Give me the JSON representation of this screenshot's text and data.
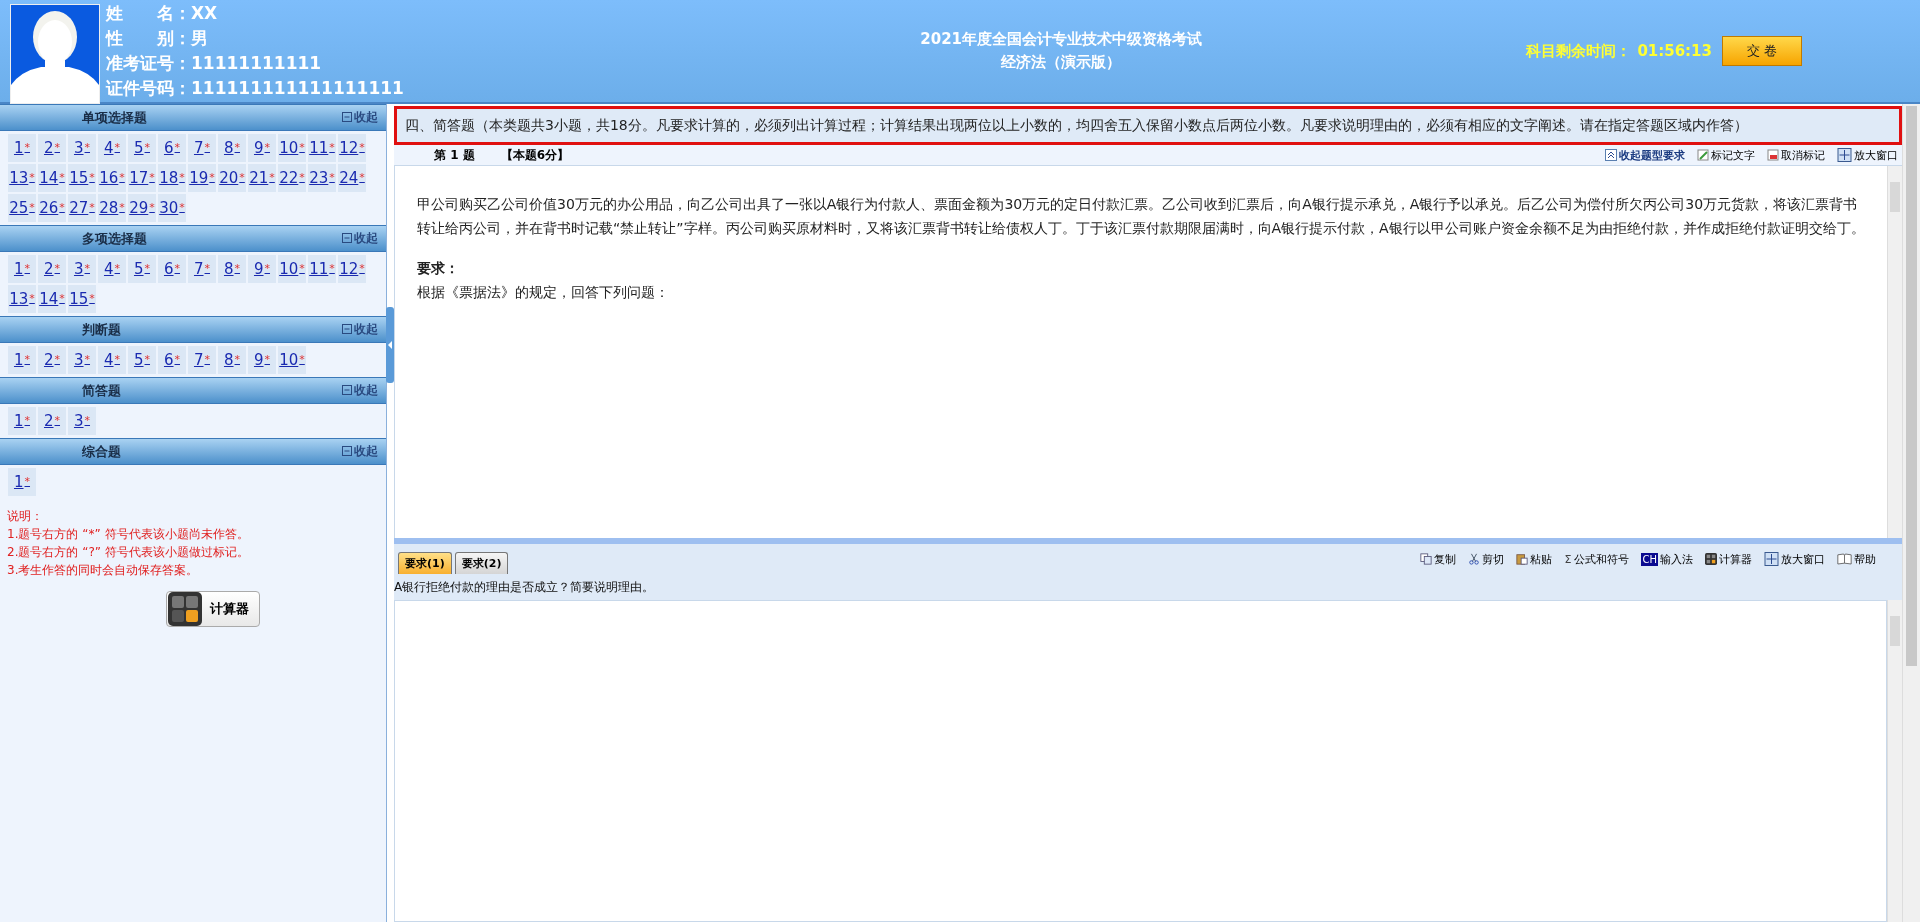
{
  "candidate": {
    "fields": [
      {
        "label": "姓　　名：",
        "value": "XX"
      },
      {
        "label": "性　　别：",
        "value": "男"
      },
      {
        "label": "准考证号：",
        "value": "11111111111"
      },
      {
        "label": "证件号码：",
        "value": "111111111111111111"
      }
    ]
  },
  "exam": {
    "title": "2021年度全国会计专业技术中级资格考试",
    "subject": "经济法（演示版）"
  },
  "timer": {
    "label": "科目剩余时间：",
    "value": "01:56:13"
  },
  "submit_button": "交 卷",
  "sections": [
    {
      "title": "单项选择题",
      "collapse": "收起",
      "items": [
        {
          "number": "1",
          "mark": "*"
        },
        {
          "number": "2",
          "mark": "*"
        },
        {
          "number": "3",
          "mark": "*"
        },
        {
          "number": "4",
          "mark": "*"
        },
        {
          "number": "5",
          "mark": "*"
        },
        {
          "number": "6",
          "mark": "*"
        },
        {
          "number": "7",
          "mark": "*"
        },
        {
          "number": "8",
          "mark": "*"
        },
        {
          "number": "9",
          "mark": "*"
        },
        {
          "number": "10",
          "mark": "*"
        },
        {
          "number": "11",
          "mark": "*"
        },
        {
          "number": "12",
          "mark": "*"
        },
        {
          "number": "13",
          "mark": "*"
        },
        {
          "number": "14",
          "mark": "*"
        },
        {
          "number": "15",
          "mark": "*"
        },
        {
          "number": "16",
          "mark": "*"
        },
        {
          "number": "17",
          "mark": "*"
        },
        {
          "number": "18",
          "mark": "*"
        },
        {
          "number": "19",
          "mark": "*"
        },
        {
          "number": "20",
          "mark": "*"
        },
        {
          "number": "21",
          "mark": "*"
        },
        {
          "number": "22",
          "mark": "*"
        },
        {
          "number": "23",
          "mark": "*"
        },
        {
          "number": "24",
          "mark": "*"
        },
        {
          "number": "25",
          "mark": "*"
        },
        {
          "number": "26",
          "mark": "*"
        },
        {
          "number": "27",
          "mark": "*"
        },
        {
          "number": "28",
          "mark": "*"
        },
        {
          "number": "29",
          "mark": "*"
        },
        {
          "number": "30",
          "mark": "*"
        }
      ]
    },
    {
      "title": "多项选择题",
      "collapse": "收起",
      "items": [
        {
          "number": "1",
          "mark": "*"
        },
        {
          "number": "2",
          "mark": "*"
        },
        {
          "number": "3",
          "mark": "*"
        },
        {
          "number": "4",
          "mark": "*"
        },
        {
          "number": "5",
          "mark": "*"
        },
        {
          "number": "6",
          "mark": "*"
        },
        {
          "number": "7",
          "mark": "*"
        },
        {
          "number": "8",
          "mark": "*"
        },
        {
          "number": "9",
          "mark": "*"
        },
        {
          "number": "10",
          "mark": "*"
        },
        {
          "number": "11",
          "mark": "*"
        },
        {
          "number": "12",
          "mark": "*"
        },
        {
          "number": "13",
          "mark": "*"
        },
        {
          "number": "14",
          "mark": "*"
        },
        {
          "number": "15",
          "mark": "*"
        }
      ]
    },
    {
      "title": "判断题",
      "collapse": "收起",
      "items": [
        {
          "number": "1",
          "mark": "*"
        },
        {
          "number": "2",
          "mark": "*"
        },
        {
          "number": "3",
          "mark": "*"
        },
        {
          "number": "4",
          "mark": "*"
        },
        {
          "number": "5",
          "mark": "*"
        },
        {
          "number": "6",
          "mark": "*"
        },
        {
          "number": "7",
          "mark": "*"
        },
        {
          "number": "8",
          "mark": "*"
        },
        {
          "number": "9",
          "mark": "*"
        },
        {
          "number": "10",
          "mark": "*"
        }
      ]
    },
    {
      "title": "简答题",
      "collapse": "收起",
      "items": [
        {
          "number": "1",
          "mark": "*"
        },
        {
          "number": "2",
          "mark": "*"
        },
        {
          "number": "3",
          "mark": "*"
        }
      ]
    },
    {
      "title": "综合题",
      "collapse": "收起",
      "items": [
        {
          "number": "1",
          "mark": "*"
        }
      ]
    }
  ],
  "notes": [
    "说明：",
    "1.题号右方的 “*” 符号代表该小题尚未作答。",
    "2.题号右方的 “?” 符号代表该小题做过标记。",
    "3.考生作答的同时会自动保存答案。"
  ],
  "calculator_button": "计算器",
  "instructions": "四、简答题（本类题共3小题，共18分。凡要求计算的，必须列出计算过程；计算结果出现两位以上小数的，均四舍五入保留小数点后两位小数。凡要求说明理由的，必须有相应的文字阐述。请在指定答题区域内作答）",
  "question": {
    "number": "第 1 题",
    "score": "【本题6分】",
    "tools": [
      {
        "kind": "collapse",
        "label": "收起题型要求"
      },
      {
        "kind": "mark",
        "label": "标记文字"
      },
      {
        "kind": "unmark",
        "label": "取消标记"
      },
      {
        "kind": "enlarge",
        "label": "放大窗口"
      }
    ],
    "body": "甲公司购买乙公司价值30万元的办公用品，向乙公司出具了一张以A银行为付款人、票面金额为30万元的定日付款汇票。乙公司收到汇票后，向A银行提示承兑，A银行予以承兑。后乙公司为偿付所欠丙公司30万元货款，将该汇票背书转让给丙公司，并在背书时记载“禁止转让”字样。丙公司购买原材料时，又将该汇票背书转让给债权人丁。丁于该汇票付款期限届满时，向A银行提示付款，A银行以甲公司账户资金余额不足为由拒绝付款，并作成拒绝付款证明交给丁。",
    "requirement_heading": "要求：",
    "requirement": "根据《票据法》的规定，回答下列问题："
  },
  "answer": {
    "tabs": [
      {
        "label": "要求(1)",
        "selected": true
      },
      {
        "label": "要求(2)",
        "selected": false
      }
    ],
    "tools": [
      {
        "kind": "copy",
        "label": "复制"
      },
      {
        "kind": "cut",
        "label": "剪切"
      },
      {
        "kind": "paste",
        "label": "粘贴"
      },
      {
        "kind": "formula",
        "label": "公式和符号",
        "icon_text": "Σ"
      },
      {
        "kind": "ime",
        "label": "输入法",
        "icon_text": "CH"
      },
      {
        "kind": "calculator",
        "label": "计算器"
      },
      {
        "kind": "enlarge",
        "label": "放大窗口"
      },
      {
        "kind": "help",
        "label": "帮助"
      }
    ],
    "prompt": "A银行拒绝付款的理由是否成立？简要说明理由。"
  }
}
